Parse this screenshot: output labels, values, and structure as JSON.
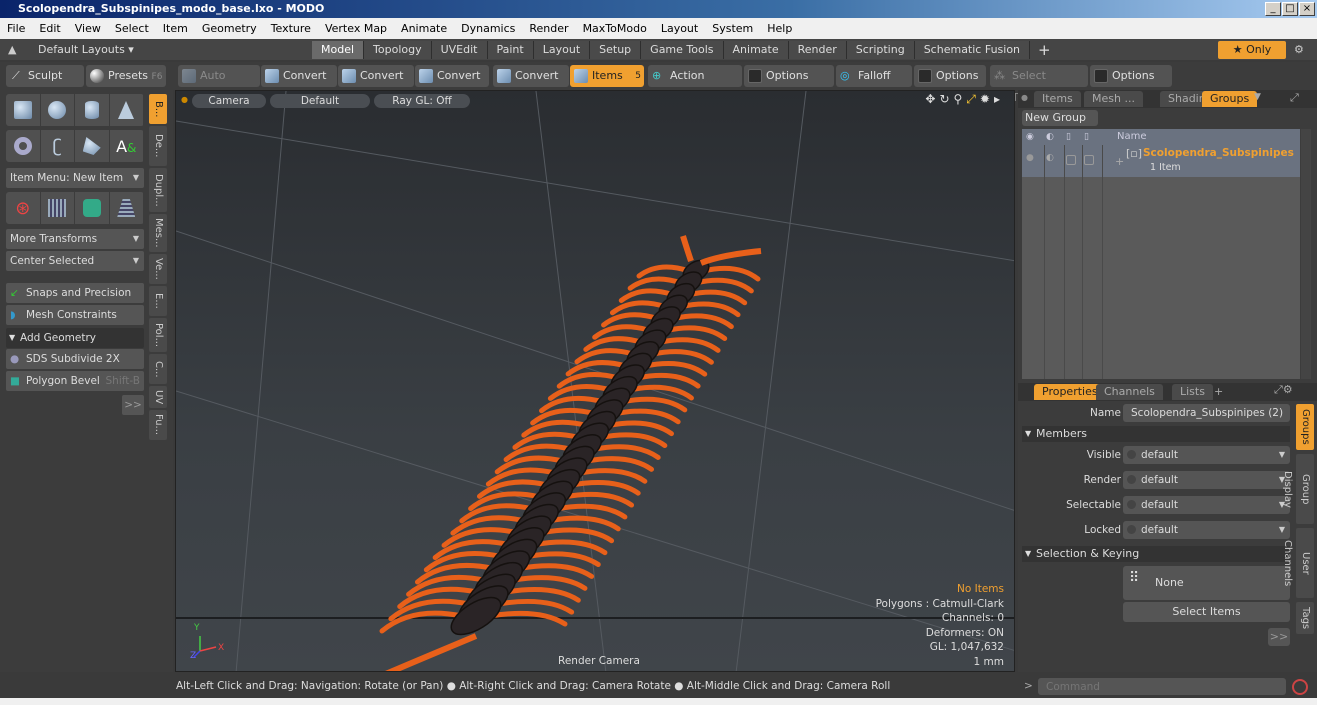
{
  "window": {
    "title": "Scolopendra_Subspinipes_modo_base.lxo - MODO",
    "controls": [
      "_",
      "□",
      "×"
    ]
  },
  "menu": [
    "File",
    "Edit",
    "View",
    "Select",
    "Item",
    "Geometry",
    "Texture",
    "Vertex Map",
    "Animate",
    "Dynamics",
    "Render",
    "MaxToModo",
    "Layout",
    "System",
    "Help"
  ],
  "layoutbar": {
    "layouts": "Default Layouts ▾",
    "tabs": [
      "Model",
      "Topology",
      "UVEdit",
      "Paint",
      "Layout",
      "Setup",
      "Game Tools",
      "Animate",
      "Render",
      "Scripting",
      "Schematic Fusion"
    ],
    "active_tab": "Model",
    "add": "+",
    "only": "★ Only"
  },
  "toolbar": {
    "sculpt": "Sculpt",
    "presets": "Presets",
    "presets_key": "F6",
    "auto_select": "Auto Select",
    "convert": [
      "Convert",
      "Convert",
      "Convert",
      "Convert"
    ],
    "items": "Items",
    "items_key": "5",
    "action_center": "Action Center",
    "options": [
      "Options",
      "Options",
      "Options"
    ],
    "falloff": "Falloff",
    "select_through": "Select Through"
  },
  "leftpanel": {
    "item_menu": "Item Menu: New Item",
    "more_transforms": "More Transforms",
    "center_selected": "Center Selected",
    "snaps": "Snaps and Precision",
    "mesh_constraints": "Mesh Constraints",
    "add_geometry": "Add Geometry",
    "sds": "SDS Subdivide 2X",
    "bevel": "Polygon Bevel",
    "bevel_key": "Shift-B",
    "more": ">>",
    "vtabs": [
      "B...",
      "De...",
      "Dupl...",
      "Mes...",
      "Ve...",
      "E...",
      "Pol...",
      "C...",
      "UV",
      "Fu..."
    ]
  },
  "viewport": {
    "camera": "Camera",
    "default": "Default",
    "raygl": "Ray GL: Off",
    "label": "Render Camera",
    "info": {
      "no_items": "No Items",
      "polygons": "Polygons : Catmull-Clark",
      "channels": "Channels: 0",
      "deformers": "Deformers: ON",
      "gl": "GL: 1,047,632",
      "unit": "1 mm"
    },
    "axes": {
      "y": "Y",
      "x": "X",
      "z": "Z"
    }
  },
  "groups_panel": {
    "tabs": [
      "Items",
      "Mesh ...",
      "Shading",
      "Groups"
    ],
    "active_tab": "Groups",
    "new_group": "New Group",
    "name_header": "Name",
    "group_name": "Scolopendra_Subspinipes",
    "group_count": "1 Item"
  },
  "properties": {
    "tabs": [
      "Properties",
      "Channels",
      "Lists"
    ],
    "add": "+",
    "name_label": "Name",
    "name_value": "Scolopendra_Subspinipes (2)",
    "members": "Members",
    "rows": [
      {
        "label": "Visible",
        "value": "default"
      },
      {
        "label": "Render",
        "value": "default"
      },
      {
        "label": "Selectable",
        "value": "default"
      },
      {
        "label": "Locked",
        "value": "default"
      }
    ],
    "selection_keying": "Selection & Keying",
    "none": "None",
    "select_items": "Select Items",
    "more": ">>",
    "side_tabs": [
      "Groups",
      "Group Display",
      "User Channels",
      "Tags"
    ]
  },
  "statusbar": {
    "hint": "Alt-Left Click and Drag: Navigation: Rotate (or Pan) ● Alt-Right Click and Drag: Camera Rotate ● Alt-Middle Click and Drag: Camera Roll",
    "command_placeholder": "Command"
  },
  "colors": {
    "accent": "#f0a030",
    "centipede_legs": "#e8601a",
    "centipede_body": "#2a2426"
  }
}
